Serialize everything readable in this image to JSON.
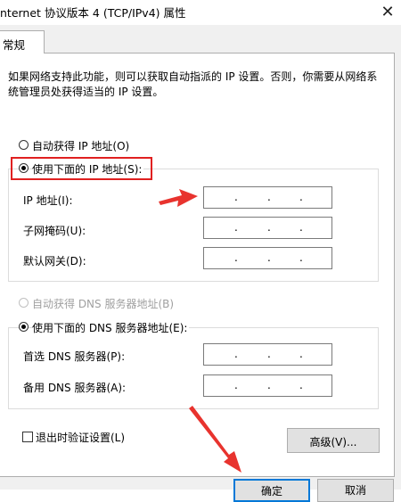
{
  "window": {
    "title": "nternet 协议版本 4 (TCP/IPv4) 属性",
    "close_glyph": "✕"
  },
  "tabs": [
    {
      "label": "常规"
    }
  ],
  "description": "如果网络支持此功能，则可以获取自动指派的 IP 设置。否则，你需要从网络系统管理员处获得适当的 IP 设置。",
  "ip": {
    "auto_label": "自动获得 IP 地址(O)",
    "manual_label": "使用下面的 IP 地址(S):",
    "selected": "manual",
    "fields": [
      {
        "label": "IP 地址(I):",
        "value": ". . ."
      },
      {
        "label": "子网掩码(U):",
        "value": ". . ."
      },
      {
        "label": "默认网关(D):",
        "value": ". . ."
      }
    ]
  },
  "dns": {
    "auto_label": "自动获得 DNS 服务器地址(B)",
    "auto_disabled": true,
    "manual_label": "使用下面的 DNS 服务器地址(E):",
    "selected": "manual",
    "fields": [
      {
        "label": "首选 DNS 服务器(P):",
        "value": ". . ."
      },
      {
        "label": "备用 DNS 服务器(A):",
        "value": ". . ."
      }
    ]
  },
  "validate_checkbox": {
    "label": "退出时验证设置(L)",
    "checked": false
  },
  "buttons": {
    "advanced": "高级(V)...",
    "ok": "确定",
    "cancel": "取消"
  },
  "annotation_color": "#e02020"
}
